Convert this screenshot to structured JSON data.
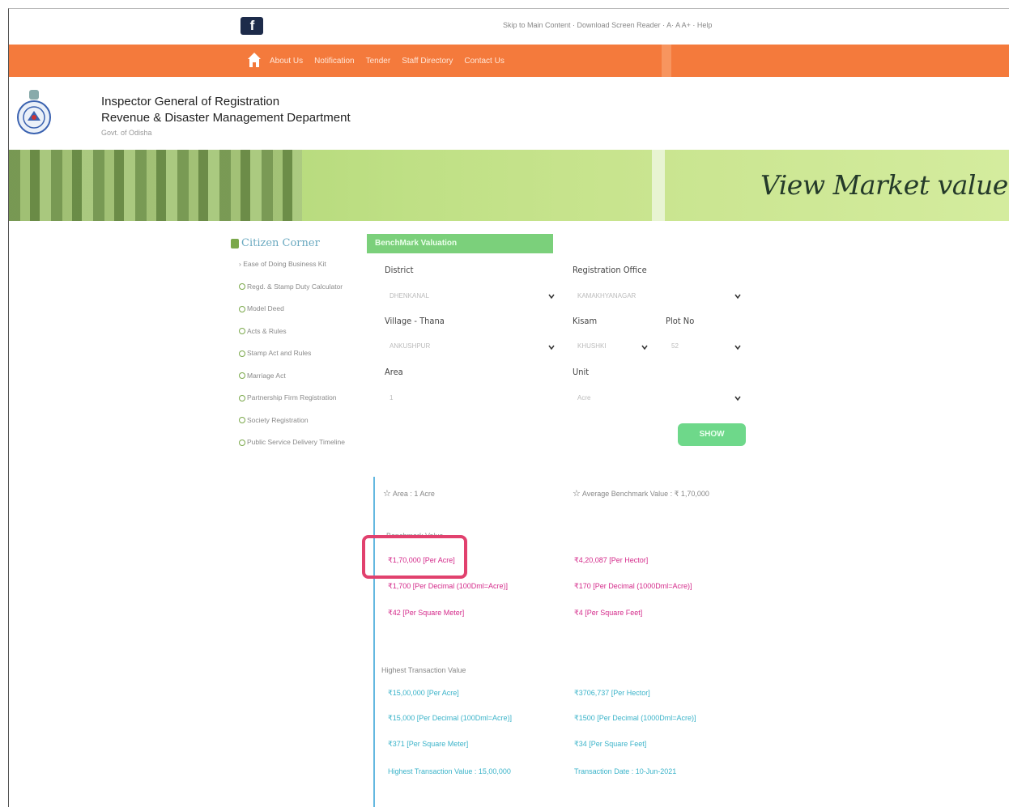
{
  "topbar": {
    "social_label": "f",
    "links_text": "Skip to Main Content · Download Screen Reader · A· A A+ · Help"
  },
  "nav": {
    "items": [
      "About Us",
      "Notification",
      "Tender",
      "Staff Directory",
      "Contact Us"
    ]
  },
  "header": {
    "title_line1": "Inspector General of Registration",
    "title_line2": "Revenue & Disaster Management Department",
    "title_line3": "Govt. of Odisha"
  },
  "banner": {
    "title": "View Market value"
  },
  "sidebar": {
    "heading": "Citizen Corner",
    "items": [
      "Ease of Doing Business Kit",
      "Regd. & Stamp Duty Calculator",
      "Model Deed",
      "Acts & Rules",
      "Stamp Act and Rules",
      "Marriage Act",
      "Partnership Firm Registration",
      "Society Registration",
      "Public Service Delivery Timeline"
    ]
  },
  "form": {
    "tab_label": "BenchMark Valuation",
    "district_label": "District",
    "district_value": "DHENKANAL",
    "reg_office_label": "Registration Office",
    "reg_office_value": "KAMAKHYANAGAR",
    "village_label": "Village - Thana",
    "village_value": "ANKUSHPUR",
    "kisam_label": "Kisam",
    "kisam_value": "KHUSHKI",
    "plot_label": "Plot No",
    "plot_value": "52",
    "area_label": "Area",
    "area_value": "1",
    "unit_label": "Unit",
    "unit_value": "Acre",
    "show_label": "SHOW"
  },
  "results": {
    "area_text": "Area : 1 Acre",
    "avg_bench_text": "Average Benchmark Value : ₹ 1,70,000",
    "bench_heading": "Benchmark Value",
    "bench_left": [
      "₹1,70,000 [Per Acre]",
      "₹1,700 [Per Decimal (100Dml=Acre)]",
      "₹42 [Per Square Meter]"
    ],
    "bench_right": [
      "₹4,20,087 [Per Hector]",
      "₹170 [Per Decimal (1000Dml=Acre)]",
      "₹4 [Per Square Feet]"
    ],
    "highest_heading": "Highest Transaction Value",
    "highest_left": [
      "₹15,00,000 [Per Acre]",
      "₹15,000 [Per Decimal (100Dml=Acre)]",
      "₹371 [Per Square Meter]",
      "Highest Transaction Value : 15,00,000"
    ],
    "highest_right": [
      "₹3706,737 [Per Hector]",
      "₹1500 [Per Decimal (1000Dml=Acre)]",
      "₹34 [Per Square Feet]",
      "Transaction Date : 10-Jun-2021"
    ]
  },
  "colors": {
    "nav_orange": "#f47a3c",
    "banner_green": "#bfe085",
    "highlight": "#e1416e",
    "value_pink": "#d42a8a",
    "value_teal": "#3ab3c9"
  }
}
